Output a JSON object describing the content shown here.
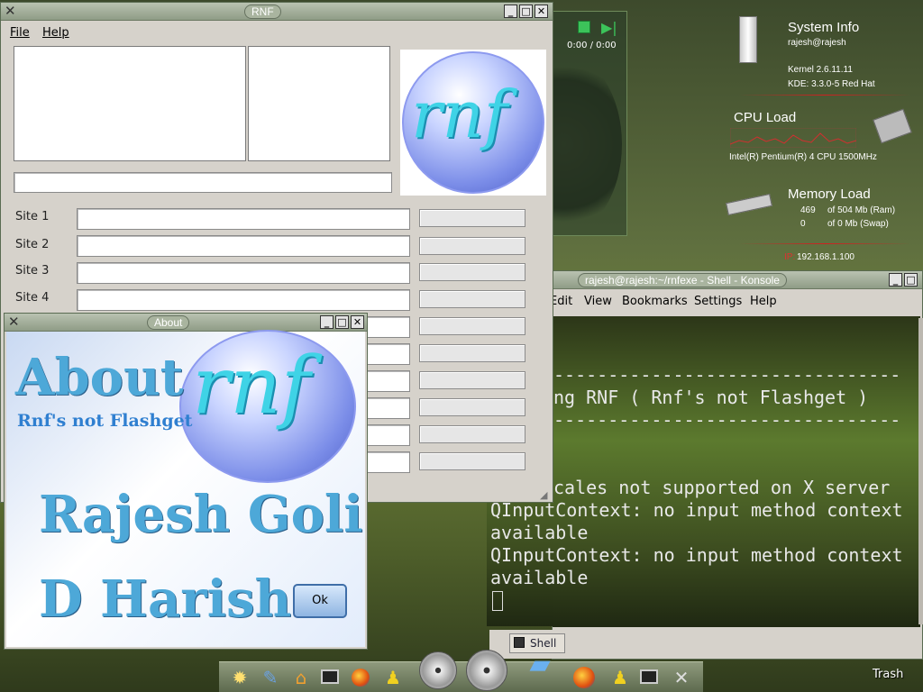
{
  "desktop": {
    "trash_label": "Trash",
    "media_player": {
      "time": "0:00 / 0:00"
    },
    "system_info": {
      "title": "System Info",
      "user": "rajesh@rajesh",
      "kernel": "Kernel 2.6.11.11",
      "kde": "KDE: 3.3.0-5 Red Hat",
      "cpu_title": "CPU Load",
      "cpu_desc": "Intel(R) Pentium(R) 4 CPU 1500MHz",
      "mem_title": "Memory Load",
      "ram_used": "469",
      "ram_text": "of 504 Mb (Ram)",
      "swap_used": "0",
      "swap_text": "of 0 Mb (Swap)",
      "ip_label": "IP:",
      "ip": "192.168.1.100"
    }
  },
  "rnf_window": {
    "title": "RNF",
    "menu": {
      "file": "File",
      "help": "Help"
    },
    "logo_text": "rnf",
    "sites": [
      "Site 1",
      "Site 2",
      "Site 3",
      "Site 4"
    ]
  },
  "about_window": {
    "title": "About",
    "heading": "About",
    "subtitle": "Rnf's not Flashget",
    "logo_text": "rnf",
    "author1": "Rajesh Goli",
    "author2": "D Harish",
    "ok_label": "Ok"
  },
  "konsole": {
    "title": "rajesh@rajesh:~/rnfexe - Shell - Konsole",
    "menu": {
      "edit": "Edit",
      "view": "View",
      "bookmarks": "Bookmarks",
      "settings": "Settings",
      "help": "Help"
    },
    "lines": [
      "--------------------------------",
      "ng RNF ( Rnf's not Flashget )",
      "--------------------------------",
      "",
      "",
      "cales not supported on X server",
      "QInputContext: no input method context",
      "available",
      "QInputContext: no input method context",
      "available"
    ],
    "tab_label": "Shell"
  },
  "colors": {
    "accent": "#4da8d8",
    "window_frame": "#8f9c86",
    "konsole_bg": "#3f4a25"
  }
}
